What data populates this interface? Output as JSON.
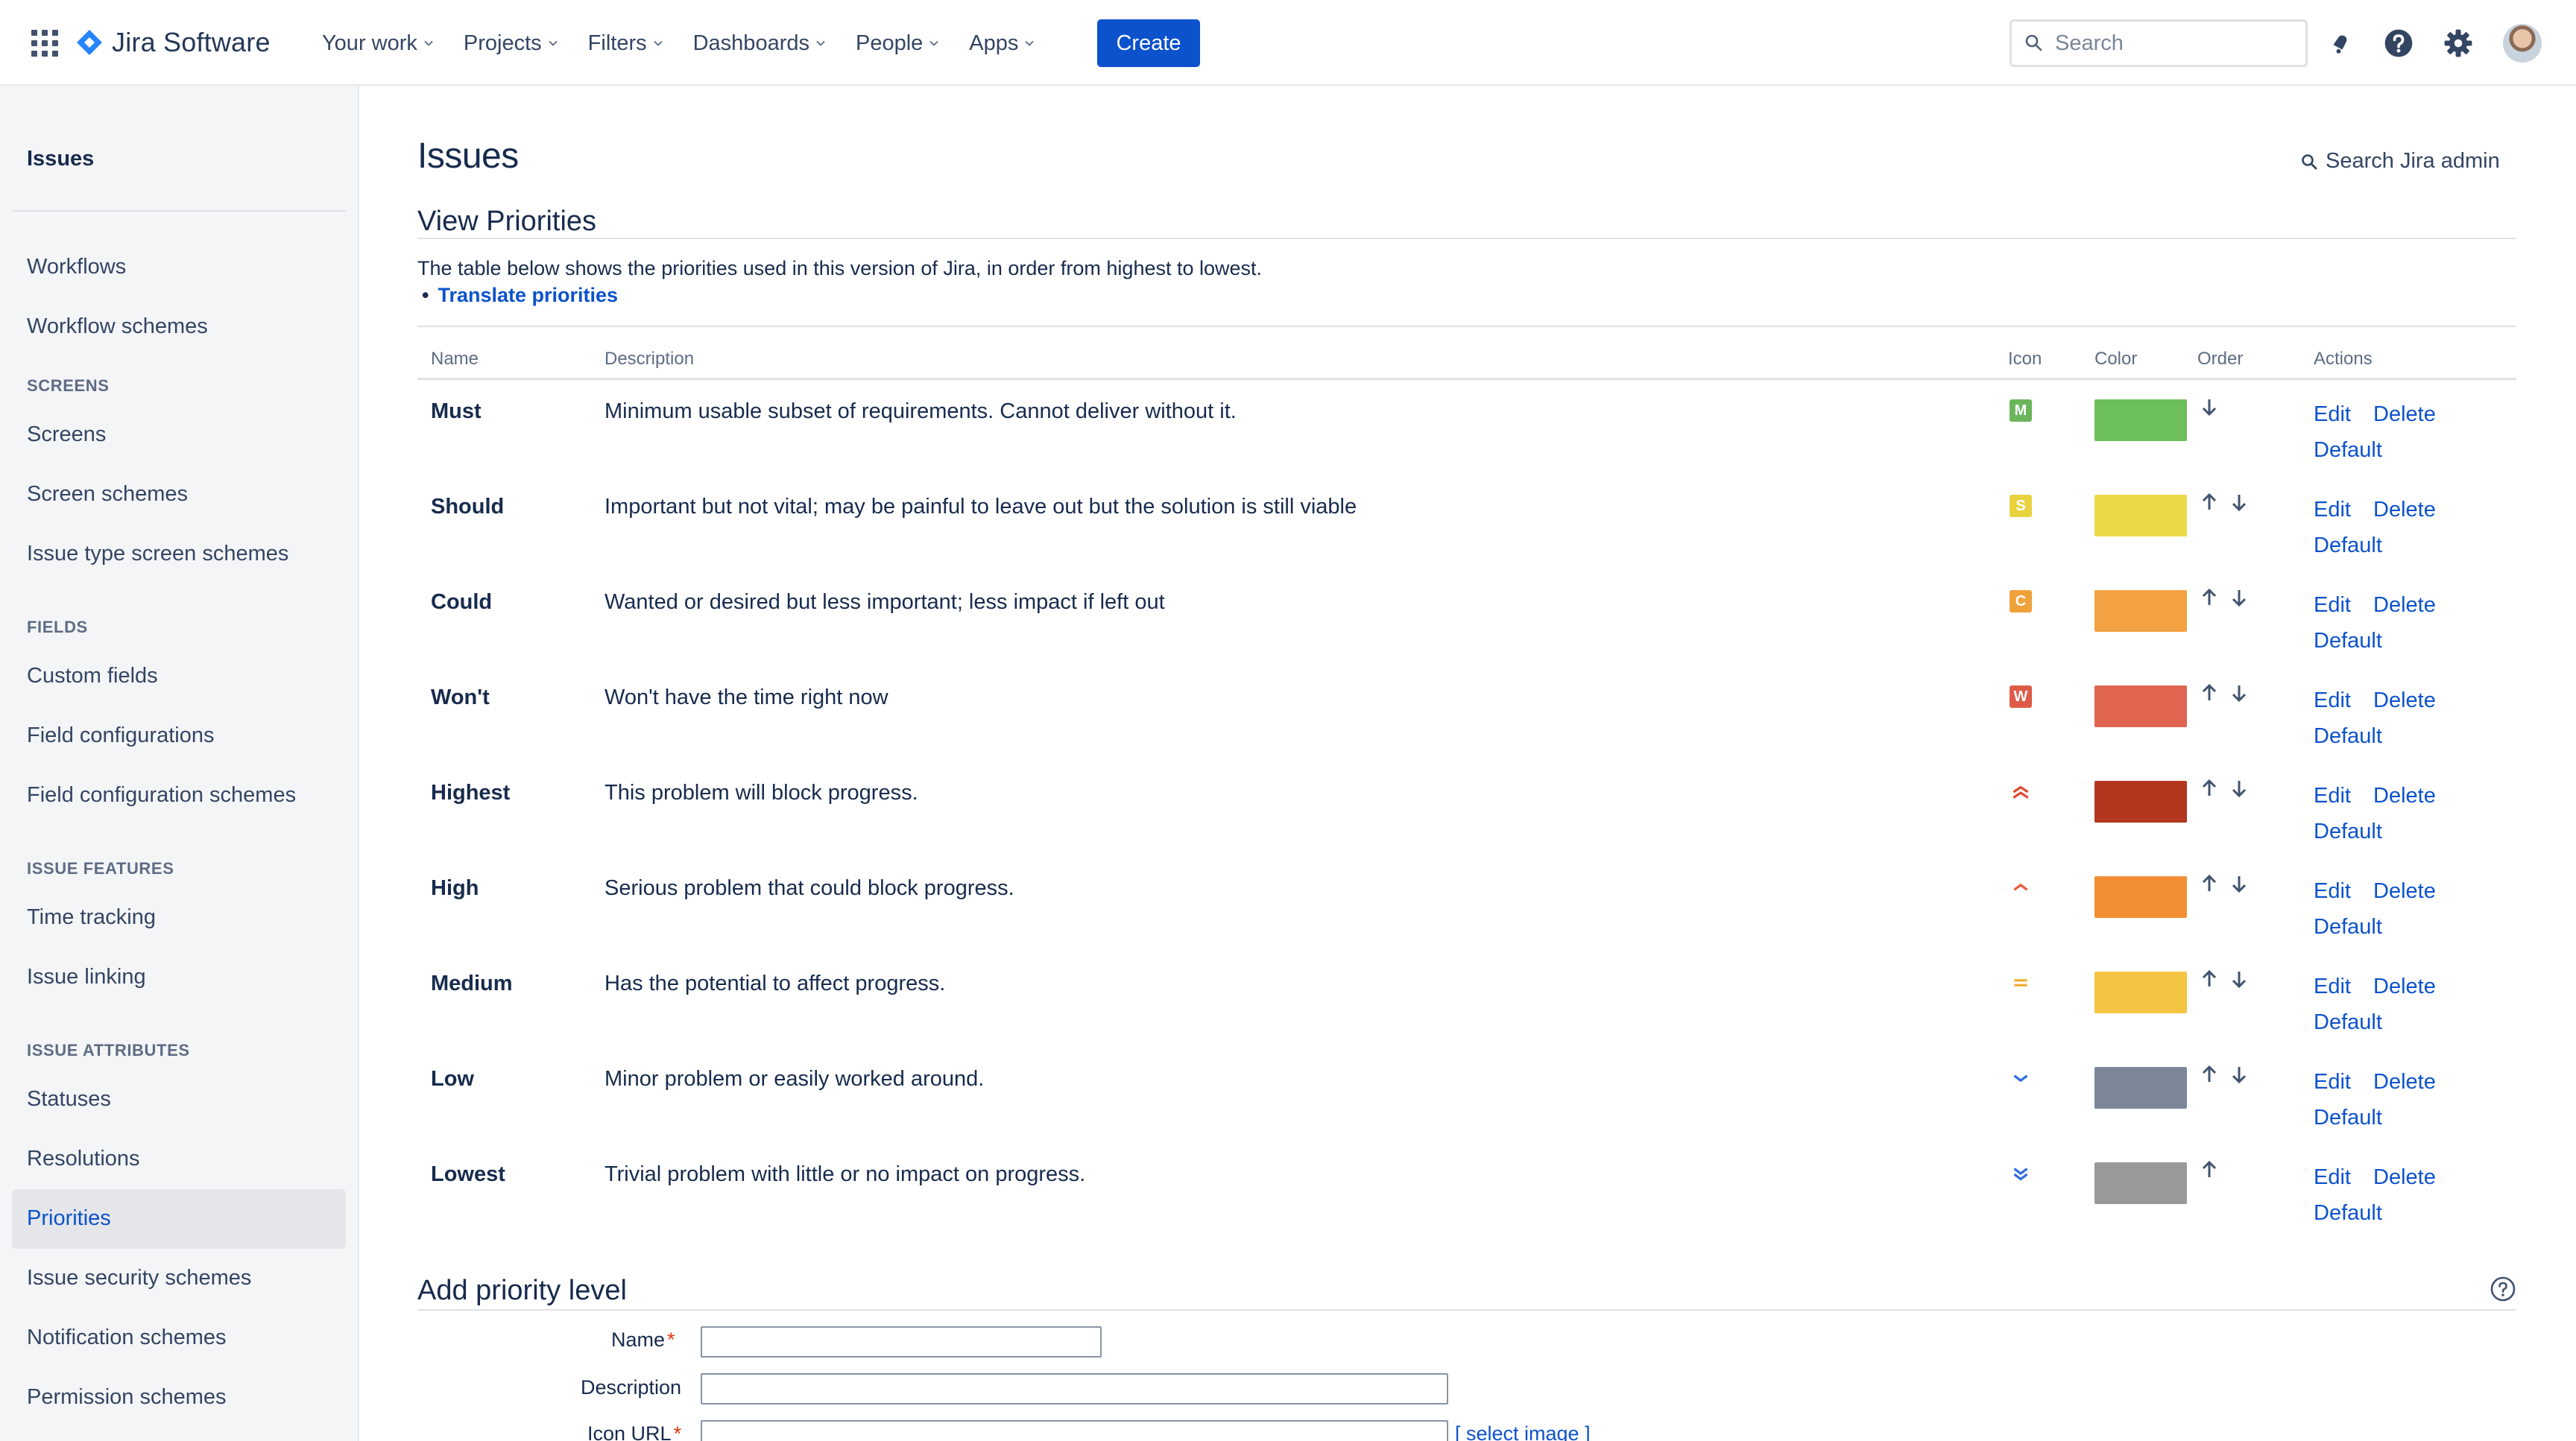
{
  "topnav": {
    "logo_text": "Jira Software",
    "items": [
      "Your work",
      "Projects",
      "Filters",
      "Dashboards",
      "People",
      "Apps"
    ],
    "create_label": "Create",
    "search_placeholder": "Search"
  },
  "sidebar": {
    "title": "Issues",
    "links_top": [
      "Workflows",
      "Workflow schemes"
    ],
    "sections": [
      {
        "heading": "SCREENS",
        "items": [
          "Screens",
          "Screen schemes",
          "Issue type screen schemes"
        ]
      },
      {
        "heading": "FIELDS",
        "items": [
          "Custom fields",
          "Field configurations",
          "Field configuration schemes"
        ]
      },
      {
        "heading": "ISSUE FEATURES",
        "items": [
          "Time tracking",
          "Issue linking"
        ]
      },
      {
        "heading": "ISSUE ATTRIBUTES",
        "items": [
          "Statuses",
          "Resolutions",
          "Priorities",
          "Issue security schemes",
          "Notification schemes",
          "Permission schemes"
        ]
      }
    ],
    "active_item": "Priorities"
  },
  "main": {
    "page_title": "Issues",
    "admin_search": "Search Jira admin",
    "view_title": "View Priorities",
    "intro": "The table below shows the priorities used in this version of Jira, in order from highest to lowest.",
    "translate_link": "Translate priorities",
    "table_headers": {
      "name": "Name",
      "description": "Description",
      "icon": "Icon",
      "color": "Color",
      "order": "Order",
      "actions": "Actions"
    },
    "actions": {
      "edit": "Edit",
      "delete": "Delete",
      "default": "Default"
    },
    "priorities": [
      {
        "name": "Must",
        "description": "Minimum usable subset of requirements. Cannot deliver without it.",
        "icon": "letter-m-icon",
        "icon_letter": "M",
        "icon_color": "#6BB55A",
        "color": "#6CBF5A",
        "up": false,
        "down": true
      },
      {
        "name": "Should",
        "description": "Important but not vital; may be painful to leave out but the solution is still viable",
        "icon": "letter-s-icon",
        "icon_letter": "S",
        "icon_color": "#E8D33F",
        "color": "#EBD947",
        "up": true,
        "down": true
      },
      {
        "name": "Could",
        "description": "Wanted or desired but less important; less impact if left out",
        "icon": "letter-c-icon",
        "icon_letter": "C",
        "icon_color": "#F0A23A",
        "color": "#F2A242",
        "up": true,
        "down": true
      },
      {
        "name": "Won't",
        "description": "Won't have the time right now",
        "icon": "letter-w-icon",
        "icon_letter": "W",
        "icon_color": "#DE5B47",
        "color": "#DF6550",
        "up": true,
        "down": true
      },
      {
        "name": "Highest",
        "description": "This problem will block progress.",
        "icon": "priority-highest-icon",
        "color": "#B3361F",
        "up": true,
        "down": true
      },
      {
        "name": "High",
        "description": "Serious problem that could block progress.",
        "icon": "priority-high-icon",
        "color": "#F28E34",
        "up": true,
        "down": true
      },
      {
        "name": "Medium",
        "description": "Has the potential to affect progress.",
        "icon": "priority-medium-icon",
        "color": "#F4C542",
        "up": true,
        "down": true
      },
      {
        "name": "Low",
        "description": "Minor problem or easily worked around.",
        "icon": "priority-low-icon",
        "color": "#7B8799",
        "up": true,
        "down": true
      },
      {
        "name": "Lowest",
        "description": "Trivial problem with little or no impact on progress.",
        "icon": "priority-lowest-icon",
        "color": "#999999",
        "up": true,
        "down": false
      }
    ]
  },
  "add_form": {
    "title": "Add priority level",
    "name_label": "Name",
    "description_label": "Description",
    "icon_url_label": "Icon URL",
    "select_image": "[ select image ]",
    "name_value": "",
    "description_value": "",
    "icon_url_value": ""
  }
}
